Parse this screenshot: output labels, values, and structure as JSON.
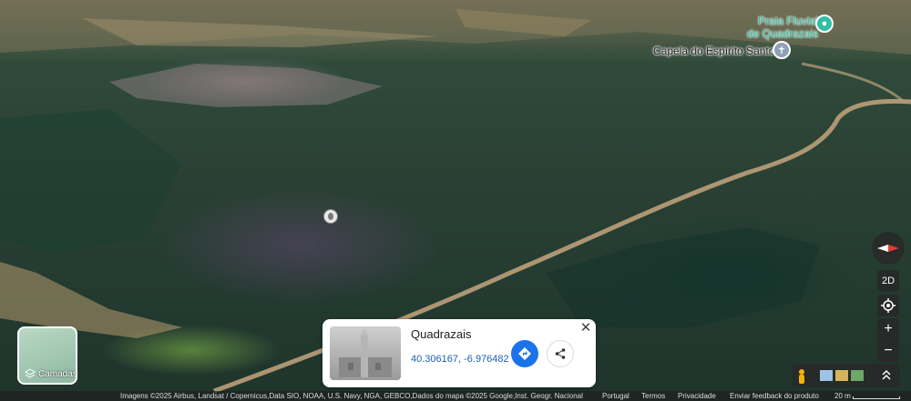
{
  "map": {
    "pois": [
      {
        "name_line1": "Praia Fluvial",
        "name_line2": "de Quadrazais",
        "color": "#2fbfa5"
      },
      {
        "name": "Capela do Espírito Santo",
        "icon": "cross-icon"
      }
    ],
    "layers_button": {
      "label": "Camadas"
    }
  },
  "place_card": {
    "title": "Quadrazais",
    "coordinates": "40.306167, -6.976482",
    "close_symbol": "✕"
  },
  "controls": {
    "view_toggle": "2D",
    "zoom_in": "+",
    "zoom_out": "−",
    "expand": "⌃"
  },
  "footer": {
    "attribution": "Imagens ©2025 Airbus, Landsat / Copernicus,Data SIO, NOAA, U.S. Navy, NGA, GEBCO,Dados do mapa ©2025 Google,Inst. Geogr. Nacional",
    "language": "Portugal",
    "terms": "Termos",
    "privacy": "Privacidade",
    "feedback": "Enviar feedback do produto",
    "scale": "20 m"
  }
}
